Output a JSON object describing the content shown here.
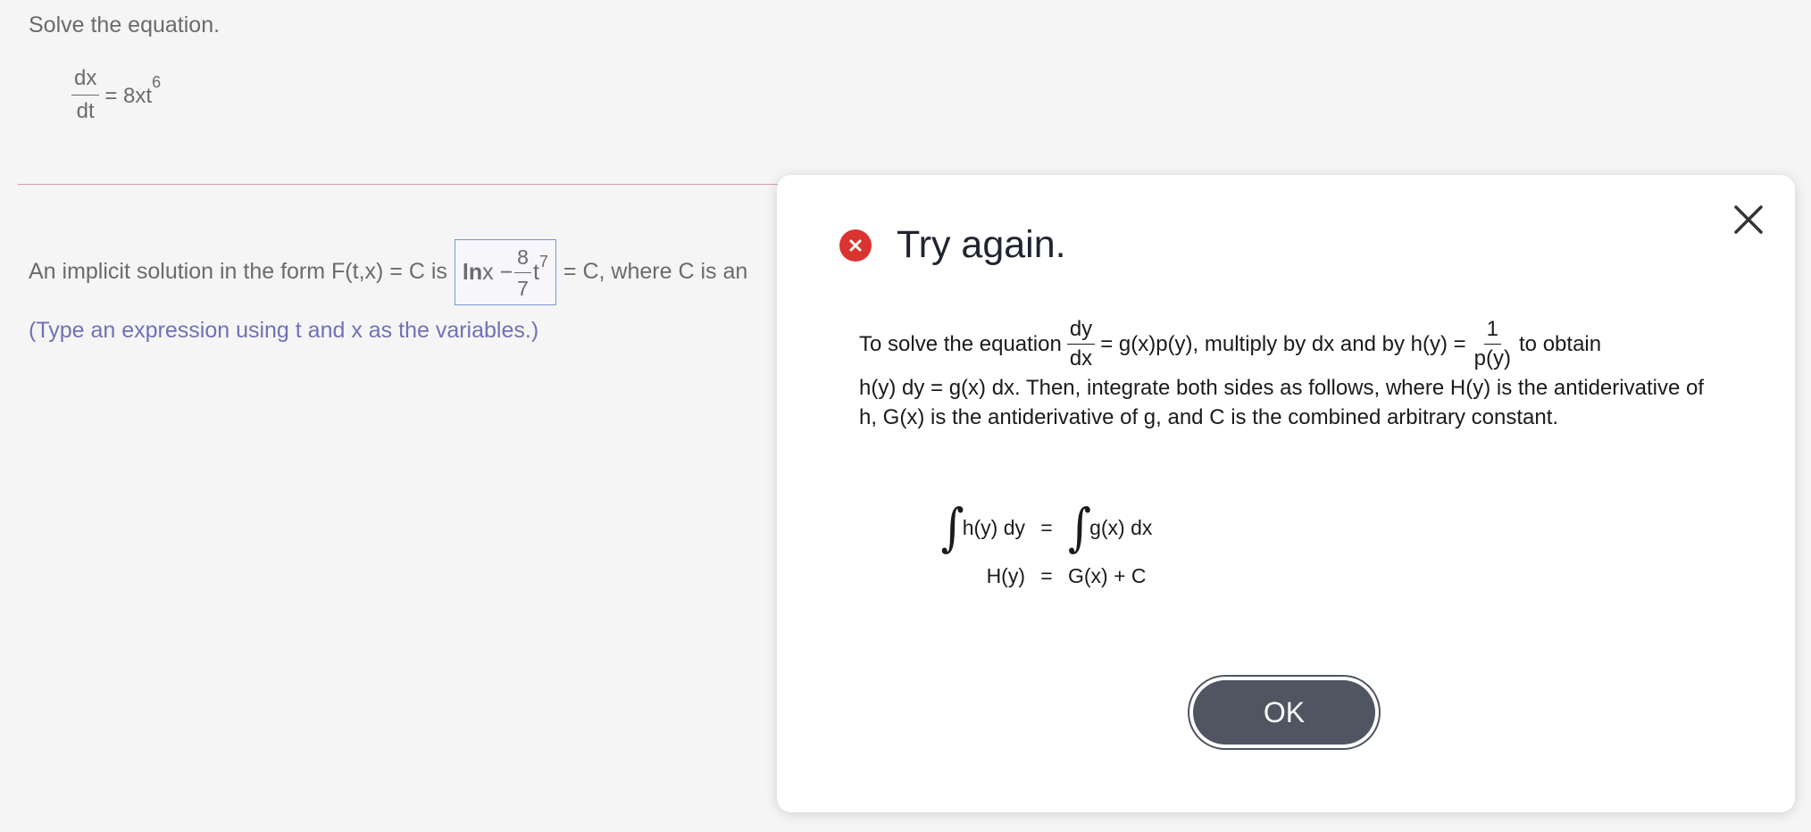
{
  "question": {
    "prompt": "Solve the equation.",
    "equation": {
      "numerator": "dx",
      "denominator": "dt",
      "rhs": "= 8xt",
      "exponent": "6"
    },
    "answer_prefix": "An implicit solution in the form F(t,x) = C is",
    "answer": {
      "ln": "ln",
      "x_minus": " x −",
      "frac_num": "8",
      "frac_den": "7",
      "t": "t",
      "exp": "7"
    },
    "answer_suffix": "= C, where C is an",
    "hint": "(Type an expression using t and x as the variables.)"
  },
  "dialog": {
    "title": "Try again.",
    "para": {
      "intro": "To solve the equation",
      "dy": "dy",
      "dx": "dx",
      "mid": "= g(x)p(y), multiply by dx and by h(y) =",
      "one": "1",
      "py": "p(y)",
      "end": "to obtain",
      "rest": "h(y) dy = g(x) dx. Then, integrate both sides as follows, where H(y) is the antiderivative of h, G(x) is the antiderivative of g, and C is the combined arbitrary constant."
    },
    "integrals": {
      "row1_left": "h(y) dy",
      "row1_eq": "=",
      "row1_right": "g(x) dx",
      "row2_left": "H(y)",
      "row2_eq": "=",
      "row2_right": "G(x) + C",
      "integral_symbol": "∫"
    },
    "ok_label": "OK"
  },
  "colors": {
    "error": "#d9342f",
    "hint": "#6f72b7",
    "ok_button": "#4f5561",
    "answer_border": "#7b97d0"
  }
}
